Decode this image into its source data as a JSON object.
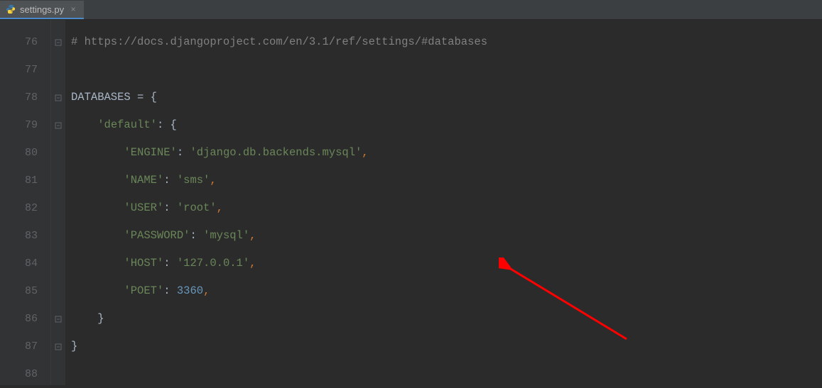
{
  "tab": {
    "filename": "settings.py",
    "icon": "python-file-icon"
  },
  "lines": [
    {
      "num": "76"
    },
    {
      "num": "77"
    },
    {
      "num": "78"
    },
    {
      "num": "79"
    },
    {
      "num": "80"
    },
    {
      "num": "81"
    },
    {
      "num": "82"
    },
    {
      "num": "83"
    },
    {
      "num": "84"
    },
    {
      "num": "85"
    },
    {
      "num": "86"
    },
    {
      "num": "87"
    },
    {
      "num": "88"
    }
  ],
  "code": {
    "l76_comment": "# https://docs.djangoproject.com/en/3.1/ref/settings/#databases",
    "l78_var": "DATABASES",
    "l78_eq": " = ",
    "l78_brace": "{",
    "l79_key": "'default'",
    "l79_colon": ": ",
    "l79_brace": "{",
    "l80_key": "'ENGINE'",
    "l80_colon": ": ",
    "l80_val": "'django.db.backends.mysql'",
    "l80_comma": ",",
    "l81_key": "'NAME'",
    "l81_colon": ": ",
    "l81_val": "'sms'",
    "l81_comma": ",",
    "l82_key": "'USER'",
    "l82_colon": ": ",
    "l82_val": "'root'",
    "l82_comma": ",",
    "l83_key": "'PASSWORD'",
    "l83_colon": ": ",
    "l83_val": "'mysql'",
    "l83_comma": ",",
    "l84_key": "'HOST'",
    "l84_colon": ": ",
    "l84_val": "'127.0.0.1'",
    "l84_comma": ",",
    "l85_key": "'POET'",
    "l85_colon": ": ",
    "l85_val": "3360",
    "l85_comma": ",",
    "l86_brace": "}",
    "l87_brace": "}"
  }
}
